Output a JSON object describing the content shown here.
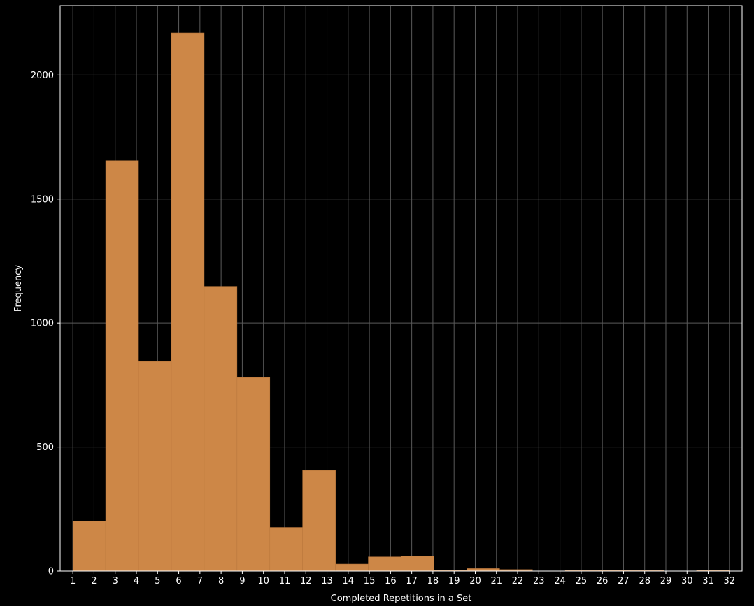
{
  "colors": {
    "background": "#000000",
    "bar_fill": "#cd8747",
    "bar_edge": "#b9773c",
    "grid": "#5a5a5a",
    "axes": "#ffffff",
    "text": "#ffffff"
  },
  "chart_data": {
    "type": "bar",
    "title": "",
    "xlabel": "Completed Repetitions in a Set",
    "ylabel": "Frequency",
    "xlim": [
      0.4,
      32.6
    ],
    "ylim": [
      0,
      2280
    ],
    "grid": true,
    "x_ticks": [
      "1",
      "2",
      "3",
      "4",
      "5",
      "6",
      "7",
      "8",
      "9",
      "10",
      "11",
      "12",
      "13",
      "14",
      "15",
      "16",
      "17",
      "18",
      "19",
      "20",
      "21",
      "22",
      "23",
      "24",
      "25",
      "26",
      "27",
      "28",
      "29",
      "30",
      "31",
      "32"
    ],
    "y_ticks": [
      "0",
      "500",
      "1000",
      "1500",
      "2000"
    ],
    "bins": [
      {
        "start": 1.0,
        "end": 2.55,
        "value": 202
      },
      {
        "start": 2.55,
        "end": 4.1,
        "value": 1655
      },
      {
        "start": 4.1,
        "end": 5.65,
        "value": 845
      },
      {
        "start": 5.65,
        "end": 7.2,
        "value": 2170
      },
      {
        "start": 7.2,
        "end": 8.75,
        "value": 1148
      },
      {
        "start": 8.75,
        "end": 10.3,
        "value": 780
      },
      {
        "start": 10.3,
        "end": 11.85,
        "value": 176
      },
      {
        "start": 11.85,
        "end": 13.4,
        "value": 405
      },
      {
        "start": 13.4,
        "end": 14.95,
        "value": 28
      },
      {
        "start": 14.95,
        "end": 16.5,
        "value": 57
      },
      {
        "start": 16.5,
        "end": 18.05,
        "value": 60
      },
      {
        "start": 18.05,
        "end": 19.6,
        "value": 3
      },
      {
        "start": 19.6,
        "end": 21.15,
        "value": 10
      },
      {
        "start": 21.15,
        "end": 22.7,
        "value": 6
      },
      {
        "start": 22.7,
        "end": 24.25,
        "value": 0
      },
      {
        "start": 24.25,
        "end": 25.8,
        "value": 2
      },
      {
        "start": 25.8,
        "end": 27.35,
        "value": 3
      },
      {
        "start": 27.35,
        "end": 28.9,
        "value": 2
      },
      {
        "start": 28.9,
        "end": 30.45,
        "value": 0
      },
      {
        "start": 30.45,
        "end": 32.0,
        "value": 3
      }
    ]
  }
}
